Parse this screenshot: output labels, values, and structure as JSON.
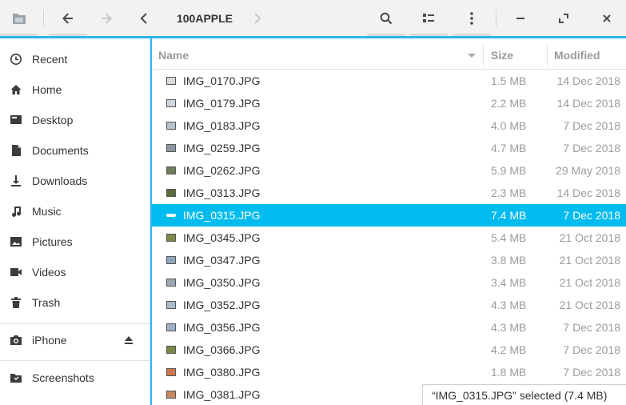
{
  "toolbar": {
    "location": "100APPLE"
  },
  "sidebar": {
    "items": [
      {
        "label": "Recent",
        "icon": "clock-icon"
      },
      {
        "label": "Home",
        "icon": "home-icon"
      },
      {
        "label": "Desktop",
        "icon": "desktop-icon"
      },
      {
        "label": "Documents",
        "icon": "document-icon"
      },
      {
        "label": "Downloads",
        "icon": "download-icon"
      },
      {
        "label": "Music",
        "icon": "music-icon"
      },
      {
        "label": "Pictures",
        "icon": "image-icon"
      },
      {
        "label": "Videos",
        "icon": "video-icon"
      },
      {
        "label": "Trash",
        "icon": "trash-icon"
      }
    ],
    "devices": [
      {
        "label": "iPhone",
        "icon": "camera-icon"
      }
    ],
    "bookmarks": [
      {
        "label": "Screenshots",
        "icon": "folder-icon"
      }
    ]
  },
  "table": {
    "headers": {
      "name": "Name",
      "size": "Size",
      "modified": "Modified"
    },
    "rows": [
      {
        "name": "IMG_0170.JPG",
        "size": "1.5 MB",
        "modified": "14 Dec 2018"
      },
      {
        "name": "IMG_0179.JPG",
        "size": "2.2 MB",
        "modified": "14 Dec 2018"
      },
      {
        "name": "IMG_0183.JPG",
        "size": "4.0 MB",
        "modified": "7 Dec 2018"
      },
      {
        "name": "IMG_0259.JPG",
        "size": "4.7 MB",
        "modified": "7 Dec 2018"
      },
      {
        "name": "IMG_0262.JPG",
        "size": "5.9 MB",
        "modified": "29 May 2018"
      },
      {
        "name": "IMG_0313.JPG",
        "size": "2.3 MB",
        "modified": "14 Dec 2018"
      },
      {
        "name": "IMG_0315.JPG",
        "size": "7.4 MB",
        "modified": "7 Dec 2018",
        "selected": true
      },
      {
        "name": "IMG_0345.JPG",
        "size": "5.4 MB",
        "modified": "21 Oct 2018"
      },
      {
        "name": "IMG_0347.JPG",
        "size": "3.8 MB",
        "modified": "21 Oct 2018"
      },
      {
        "name": "IMG_0350.JPG",
        "size": "3.4 MB",
        "modified": "21 Oct 2018"
      },
      {
        "name": "IMG_0352.JPG",
        "size": "4.3 MB",
        "modified": "21 Oct 2018"
      },
      {
        "name": "IMG_0356.JPG",
        "size": "4.3 MB",
        "modified": "7 Dec 2018"
      },
      {
        "name": "IMG_0366.JPG",
        "size": "4.2 MB",
        "modified": "7 Dec 2018"
      },
      {
        "name": "IMG_0380.JPG",
        "size": "1.8 MB",
        "modified": "7 Dec 2018"
      },
      {
        "name": "IMG_0381.JPG",
        "size": "",
        "modified": ""
      }
    ]
  },
  "status": {
    "text": "“IMG_0315.JPG” selected  (7.4 MB)"
  },
  "colors": {
    "accent": "#00bbee",
    "border": "#28b7f0"
  }
}
